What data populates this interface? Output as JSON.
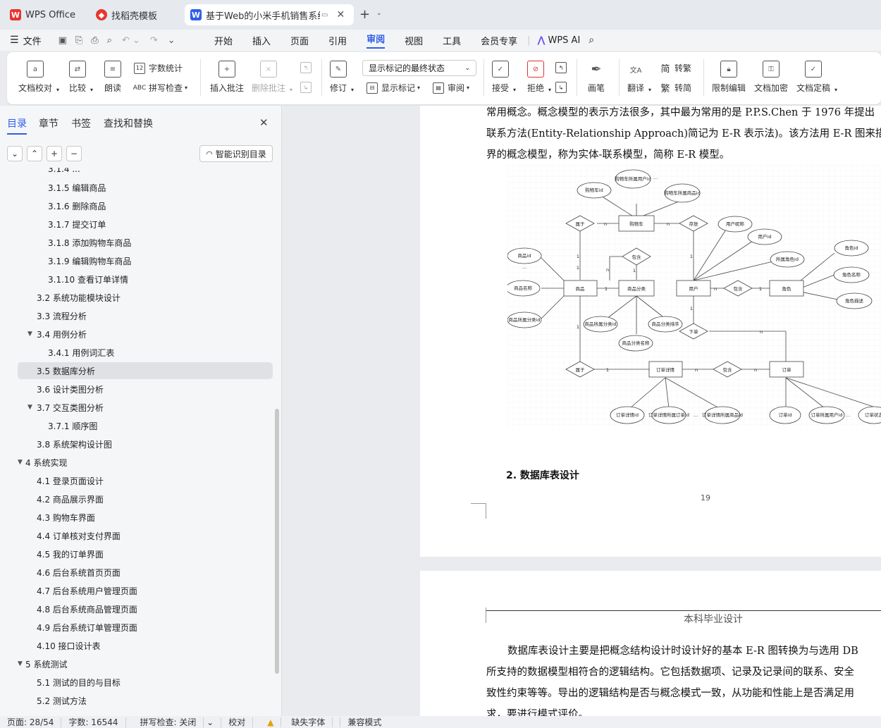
{
  "tabs": [
    {
      "label": "WPS Office"
    },
    {
      "label": "找稻壳模板"
    },
    {
      "label": "基于Web的小米手机销售系统"
    }
  ],
  "menu": {
    "file": "文件",
    "items": [
      "开始",
      "插入",
      "页面",
      "引用",
      "审阅",
      "视图",
      "工具",
      "会员专享"
    ],
    "ai": "WPS AI"
  },
  "ribbon": {
    "proofread": "文档校对",
    "compare": "比较",
    "read": "朗读",
    "wordcount": "字数统计",
    "spellcheck": "拼写检查",
    "insert_comment": "插入批注",
    "delete_comment": "删除批注",
    "revise": "修订",
    "markup_state": "显示标记的最终状态",
    "show_markup": "显示标记",
    "review": "审阅",
    "accept": "接受",
    "reject": "拒绝",
    "pen": "画笔",
    "translate": "翻译",
    "to_traditional": "转繁",
    "to_simplified": "转简",
    "restrict": "限制编辑",
    "encrypt": "文档加密",
    "finalize": "文档定稿"
  },
  "sidebar": {
    "tabs": [
      "目录",
      "章节",
      "书签",
      "查找和替换"
    ],
    "smart_toc": "智能识别目录",
    "toc": [
      {
        "label": "3.1.4 ...",
        "level": 3
      },
      {
        "label": "3.1.5 编辑商品",
        "level": 3
      },
      {
        "label": "3.1.6 删除商品",
        "level": 3
      },
      {
        "label": "3.1.7 提交订单",
        "level": 3
      },
      {
        "label": "3.1.8 添加购物车商品",
        "level": 3
      },
      {
        "label": "3.1.9 编辑购物车商品",
        "level": 3
      },
      {
        "label": "3.1.10 查看订单详情",
        "level": 3
      },
      {
        "label": "3.2  系统功能模块设计",
        "level": 2
      },
      {
        "label": "3.3  流程分析",
        "level": 2
      },
      {
        "label": "3.4  用例分析",
        "level": 2,
        "expand": true
      },
      {
        "label": "3.4.1 用例词汇表",
        "level": 3
      },
      {
        "label": "3.5  数据库分析",
        "level": 2,
        "selected": true
      },
      {
        "label": "3.6 设计类图分析",
        "level": 2
      },
      {
        "label": "3.7  交互类图分析",
        "level": 2,
        "expand": true
      },
      {
        "label": "3.7.1 顺序图",
        "level": 3
      },
      {
        "label": "3.8  系统架构设计图",
        "level": 2
      },
      {
        "label": "4  系统实现",
        "level": 1,
        "expand": true
      },
      {
        "label": "4.1 登录页面设计",
        "level": 2
      },
      {
        "label": "4.2 商品展示界面",
        "level": 2
      },
      {
        "label": "4.3  购物车界面",
        "level": 2
      },
      {
        "label": "4.4 订单核对支付界面",
        "level": 2
      },
      {
        "label": "4.5 我的订单界面",
        "level": 2
      },
      {
        "label": "4.6 后台系统首页页面",
        "level": 2
      },
      {
        "label": "4.7 后台系统用户管理页面",
        "level": 2
      },
      {
        "label": "4.8 后台系统商品管理页面",
        "level": 2
      },
      {
        "label": "4.9 后台系统订单管理页面",
        "level": 2
      },
      {
        "label": "4.10 接口设计表",
        "level": 2
      },
      {
        "label": "5  系统测试",
        "level": 1,
        "expand": true
      },
      {
        "label": "5.1  测试的目的与目标",
        "level": 2
      },
      {
        "label": "5.2  测试方法",
        "level": 2
      }
    ]
  },
  "doc": {
    "p1_lines": [
      "常用概念。概念模型的表示方法很多，其中最为常用的是 P.P.S.Chen 于 1976 年提出",
      "联系方法(Entity-Relationship Approach)简记为 E-R 表示法)。该方法用 E-R 图来描",
      "界的概念模型，称为实体-联系模型，简称 E-R 模型。"
    ],
    "heading": "2.   数据库表设计",
    "page_num": "19",
    "header2": "本科毕业设计",
    "p2_lines": [
      "数据库表设计主要是把概念结构设计时设计好的基本 E-R 图转换为与选用 DB",
      "所支持的数据模型相符合的逻辑结构。它包括数据项、记录及记录间的联系、安全",
      "致性约束等等。导出的逻辑结构是否与概念模式一致，从功能和性能上是否满足用",
      "求，要进行模式评价。"
    ]
  },
  "er": {
    "entities": [
      "购物车",
      "商品",
      "商品分类",
      "用户",
      "角色",
      "订单详情",
      "订单"
    ],
    "relations": [
      "属于",
      "存放",
      "包含",
      "包含",
      "下单",
      "属于",
      "包含"
    ],
    "attributes": [
      "购物车id",
      "购物车所属用户id",
      "购物车所属商品id",
      "用户昵称",
      "用户id",
      "所属角色id",
      "角色id",
      "角色名称",
      "角色描述",
      "商品id",
      "商品名称",
      "商品所属分类id",
      "商品所属分类id",
      "商品分类排序",
      "商品分类名称",
      "订单详情id",
      "订单详情所属订单id",
      "订单详情所属商品id",
      "订单id",
      "订单所属用户id",
      "订单状态"
    ],
    "cardinality": [
      "n",
      "n",
      "1",
      "1",
      "n",
      "1",
      "1",
      "n",
      "1",
      "1",
      "1",
      "n",
      "1",
      "n",
      "n",
      "1"
    ]
  },
  "status": {
    "page": "页面: 28/54",
    "words": "字数: 16544",
    "spell": "拼写检查: 关闭",
    "proof": "校对",
    "font": "缺失字体",
    "compat": "兼容模式"
  }
}
